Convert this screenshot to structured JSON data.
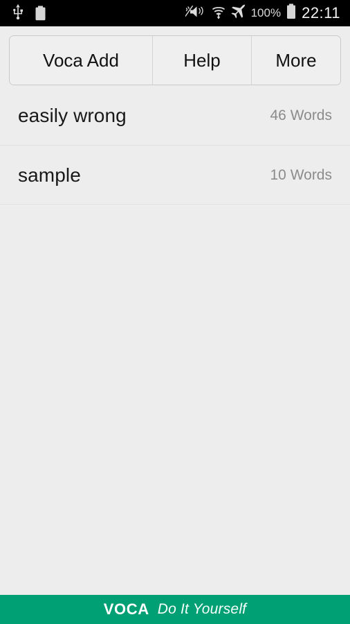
{
  "status_bar": {
    "usb_icon": "usb-icon",
    "battery_charge_icon": "battery-charge-icon",
    "battery_charge_label": "100",
    "mute_vibrate_icon": "mute-vibrate-icon",
    "wifi_icon": "wifi-icon",
    "airplane_icon": "airplane-mode-icon",
    "battery_percent": "100%",
    "battery_icon": "battery-full-icon",
    "clock": "22:11"
  },
  "toolbar": {
    "buttons": [
      {
        "label": "Voca Add",
        "name": "voca-add-button"
      },
      {
        "label": "Help",
        "name": "help-button"
      },
      {
        "label": "More",
        "name": "more-button"
      }
    ]
  },
  "list": {
    "rows": [
      {
        "title": "easily wrong",
        "count": "46 Words"
      },
      {
        "title": "sample",
        "count": "10 Words"
      }
    ]
  },
  "footer": {
    "brand": "VOCA",
    "tagline": "Do It Yourself"
  },
  "colors": {
    "background": "#ededed",
    "status_bar": "#000000",
    "footer_accent": "#00a074",
    "button_face": "#efefef",
    "button_border": "#c9c9c9",
    "title_text": "#191919",
    "count_text": "#8b8b8b"
  }
}
